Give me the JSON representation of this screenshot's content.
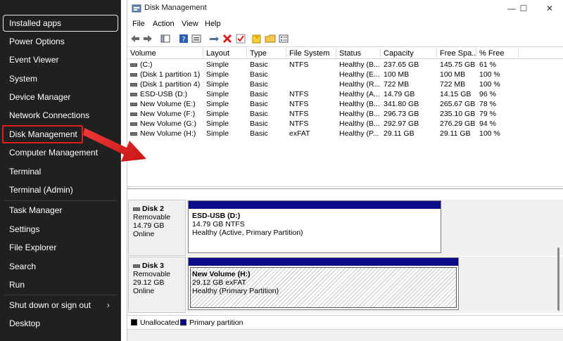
{
  "winx_menu": {
    "items": [
      {
        "label": "Installed apps"
      },
      {
        "label": "Power Options"
      },
      {
        "label": "Event Viewer"
      },
      {
        "label": "System"
      },
      {
        "label": "Device Manager"
      },
      {
        "label": "Network Connections"
      },
      {
        "label": "Disk Management"
      },
      {
        "label": "Computer Management"
      },
      {
        "label": "Terminal"
      },
      {
        "label": "Terminal (Admin)"
      },
      {
        "label": "Task Manager"
      },
      {
        "label": "Settings"
      },
      {
        "label": "File Explorer"
      },
      {
        "label": "Search"
      },
      {
        "label": "Run"
      },
      {
        "label": "Shut down or sign out"
      },
      {
        "label": "Desktop"
      }
    ],
    "submenu_glyph": "›"
  },
  "window": {
    "title": "Disk Management",
    "controls": {
      "minimize": "—",
      "maximize": "☐",
      "close": "✕"
    }
  },
  "menubar": [
    "File",
    "Action",
    "View",
    "Help"
  ],
  "toolbar_icons": [
    "back-arrow-icon",
    "forward-arrow-icon",
    "console-icon",
    "help-icon",
    "properties-icon",
    "connect-icon",
    "delete-icon",
    "check-icon",
    "new-volume-icon",
    "open-icon",
    "list-icon"
  ],
  "volume_table": {
    "columns": [
      "Volume",
      "Layout",
      "Type",
      "File System",
      "Status",
      "Capacity",
      "Free Spa...",
      "% Free"
    ],
    "rows": [
      [
        "(C:)",
        "Simple",
        "Basic",
        "NTFS",
        "Healthy (B...",
        "237.65 GB",
        "145.75 GB",
        "61 %"
      ],
      [
        "(Disk 1 partition 1)",
        "Simple",
        "Basic",
        "",
        "Healthy (E...",
        "100 MB",
        "100 MB",
        "100 %"
      ],
      [
        "(Disk 1 partition 4)",
        "Simple",
        "Basic",
        "",
        "Healthy (R...",
        "722 MB",
        "722 MB",
        "100 %"
      ],
      [
        "ESD-USB (D:)",
        "Simple",
        "Basic",
        "NTFS",
        "Healthy (A...",
        "14.79 GB",
        "14.15 GB",
        "96 %"
      ],
      [
        "New Volume (E:)",
        "Simple",
        "Basic",
        "NTFS",
        "Healthy (B...",
        "341.80 GB",
        "265.67 GB",
        "78 %"
      ],
      [
        "New Volume (F:)",
        "Simple",
        "Basic",
        "NTFS",
        "Healthy (B...",
        "296.73 GB",
        "235.10 GB",
        "79 %"
      ],
      [
        "New Volume (G:)",
        "Simple",
        "Basic",
        "NTFS",
        "Healthy (B...",
        "292.97 GB",
        "276.29 GB",
        "94 %"
      ],
      [
        "New Volume (H:)",
        "Simple",
        "Basic",
        "exFAT",
        "Healthy (P...",
        "29.11 GB",
        "29.11 GB",
        "100 %"
      ]
    ]
  },
  "disks": [
    {
      "name": "Disk 2",
      "kind": "Removable",
      "size": "14.79 GB",
      "state": "Online",
      "partition": {
        "name": "ESD-USB  (D:)",
        "size": "14.79 GB NTFS",
        "status": "Healthy (Active, Primary Partition)"
      }
    },
    {
      "name": "Disk 3",
      "kind": "Removable",
      "size": "29.12 GB",
      "state": "Online",
      "partition": {
        "name": "New Volume  (H:)",
        "size": "29.12 GB exFAT",
        "status": "Healthy (Primary Partition)"
      }
    }
  ],
  "legend": [
    {
      "label": "Unallocated",
      "color": "#000000"
    },
    {
      "label": "Primary partition",
      "color": "#0a0a8a"
    }
  ],
  "colors": {
    "menu_bg": "#202020",
    "highlight": "#e01b1b",
    "primary_partition": "#0a0a8a"
  }
}
